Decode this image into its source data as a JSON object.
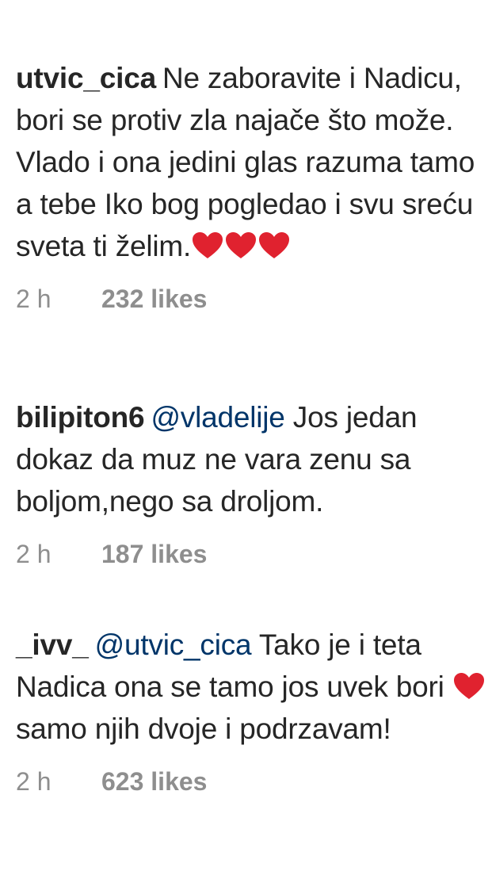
{
  "comments": [
    {
      "username": "utvic_cica",
      "mention": "",
      "text_before": "Ne zaboravite i Nadicu, bori se protiv zla najače što može. Vlado i ona jedini glas razuma tamo a tebe Iko bog pogledao i svu sreću sveta ti želim.",
      "text_after": "",
      "hearts": 3,
      "time": "2 h",
      "likes": "232 likes"
    },
    {
      "username": "bilipiton6",
      "mention": "@vladelije",
      "text_before": "Jos jedan dokaz da muz ne vara zenu sa boljom,nego sa droljom.",
      "text_after": "",
      "hearts": 0,
      "time": "2 h",
      "likes": "187 likes"
    },
    {
      "username": "_ivv_",
      "mention": "@utvic_cica",
      "text_before": "Tako je i teta Nadica ona se tamo jos uvek bori",
      "text_after": "samo njih dvoje i podrzavam!",
      "hearts": 1,
      "time": "2 h",
      "likes": "623 likes"
    }
  ],
  "colors": {
    "text": "#262626",
    "mention": "#003569",
    "meta": "#8e8e8e",
    "heart": "#e0222f"
  },
  "icons": {
    "heart": "red-heart-emoji-icon"
  }
}
